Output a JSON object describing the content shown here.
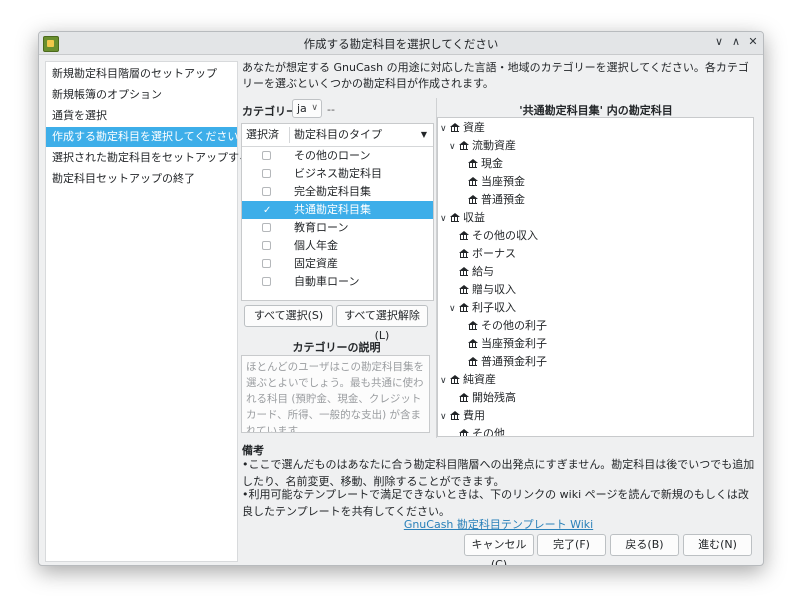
{
  "window": {
    "title": "作成する勘定科目を選択してください"
  },
  "sidebar": {
    "items": [
      {
        "label": "新規勘定科目階層のセットアップ"
      },
      {
        "label": "新規帳簿のオプション"
      },
      {
        "label": "通貨を選択"
      },
      {
        "label": "作成する勘定科目を選択してください",
        "active": true
      },
      {
        "label": "選択された勘定科目をセットアップする"
      },
      {
        "label": "勘定科目セットアップの終了"
      }
    ]
  },
  "intro": "あなたが想定する GnuCash の用途に対応した言語・地域のカテゴリーを選択してください。各カテゴリーを選ぶといくつかの勘定科目が作成されます。",
  "category": {
    "label": "カテゴリー",
    "language": "ja",
    "dash": "--"
  },
  "list": {
    "col_selected": "選択済",
    "col_type": "勘定科目のタイプ",
    "rows": [
      {
        "label": "その他のローン",
        "checked": false
      },
      {
        "label": "ビジネス勘定科目",
        "checked": false
      },
      {
        "label": "完全勘定科目集",
        "checked": false
      },
      {
        "label": "共通勘定科目集",
        "checked": true,
        "selected": true
      },
      {
        "label": "教育ローン",
        "checked": false
      },
      {
        "label": "個人年金",
        "checked": false
      },
      {
        "label": "固定資産",
        "checked": false
      },
      {
        "label": "自動車ローン",
        "checked": false
      }
    ]
  },
  "buttons": {
    "select_all": "すべて選択(S)",
    "clear_all": "すべて選択解除(L)",
    "cancel": "キャンセル(C)",
    "finish": "完了(F)",
    "back": "戻る(B)",
    "next": "進む(N)"
  },
  "description": {
    "title": "カテゴリーの説明",
    "text": "ほとんどのユーザはこの勘定科目集を選ぶとよいでしょう。最も共通に使われる科目 (預貯金、現金、クレジットカード、所得、一般的な支出) が含まれています。"
  },
  "tree": {
    "title": "'共通勘定科目集' 内の勘定科目",
    "nodes": [
      {
        "label": "資産",
        "level": 0,
        "expander": "∨"
      },
      {
        "label": "流動資産",
        "level": 1,
        "expander": "∨"
      },
      {
        "label": "現金",
        "level": 2,
        "expander": ""
      },
      {
        "label": "当座預金",
        "level": 2,
        "expander": ""
      },
      {
        "label": "普通預金",
        "level": 2,
        "expander": ""
      },
      {
        "label": "収益",
        "level": 0,
        "expander": "∨"
      },
      {
        "label": "その他の収入",
        "level": 1,
        "expander": ""
      },
      {
        "label": "ボーナス",
        "level": 1,
        "expander": ""
      },
      {
        "label": "給与",
        "level": 1,
        "expander": ""
      },
      {
        "label": "贈与収入",
        "level": 1,
        "expander": ""
      },
      {
        "label": "利子収入",
        "level": 1,
        "expander": "∨"
      },
      {
        "label": "その他の利子",
        "level": 2,
        "expander": ""
      },
      {
        "label": "当座預金利子",
        "level": 2,
        "expander": ""
      },
      {
        "label": "普通預金利子",
        "level": 2,
        "expander": ""
      },
      {
        "label": "純資産",
        "level": 0,
        "expander": "∨"
      },
      {
        "label": "開始残高",
        "level": 1,
        "expander": ""
      },
      {
        "label": "費用",
        "level": 0,
        "expander": "∨"
      },
      {
        "label": "その他",
        "level": 1,
        "expander": ""
      }
    ]
  },
  "notes": {
    "heading": "備考",
    "items": [
      "•ここで選んだものはあなたに合う勘定科目階層への出発点にすぎません。勘定科目は後でいつでも追加したり、名前変更、移動、削除することができます。",
      "•利用可能なテンプレートで満足できないときは、下のリンクの wiki ページを読んで新規のもしくは改良したテンプレートを共有してください。"
    ]
  },
  "link": "GnuCash 勘定科目テンプレート Wiki",
  "colors": {
    "accent": "#3daee9",
    "link": "#2980b9"
  }
}
